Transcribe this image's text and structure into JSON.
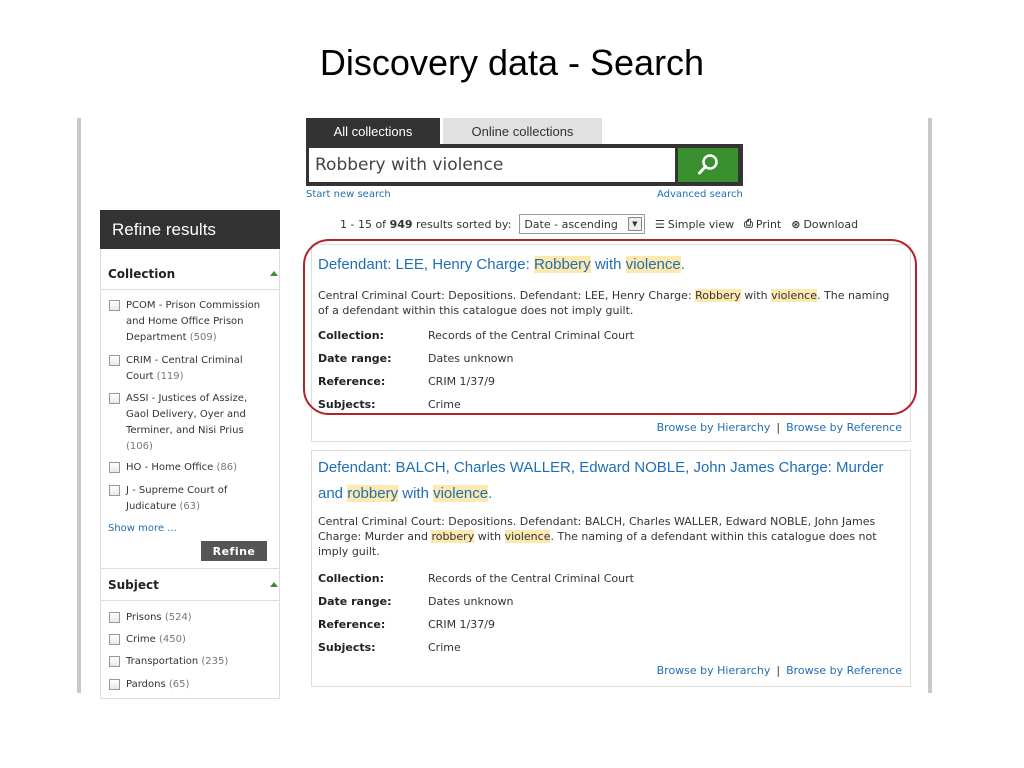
{
  "slide": {
    "title": "Discovery data - Search"
  },
  "search": {
    "tabs": [
      "All collections",
      "Online collections"
    ],
    "query": "Robbery with violence",
    "start_new": "Start new search",
    "advanced": "Advanced search"
  },
  "sidebar": {
    "header": "Refine results",
    "collection": {
      "title": "Collection",
      "items": [
        {
          "label": "PCOM - Prison Commission and Home Office Prison Department",
          "count": "(509)"
        },
        {
          "label": "CRIM - Central Criminal Court",
          "count": "(119)"
        },
        {
          "label": "ASSI - Justices of Assize, Gaol Delivery, Oyer and Terminer, and Nisi Prius",
          "count": "(106)"
        },
        {
          "label": "HO - Home Office",
          "count": "(86)"
        },
        {
          "label": "J - Supreme Court of Judicature",
          "count": "(63)"
        }
      ],
      "show_more": "Show more ...",
      "refine_button": "Refine"
    },
    "subject": {
      "title": "Subject",
      "items": [
        {
          "label": "Prisons",
          "count": "(524)"
        },
        {
          "label": "Crime",
          "count": "(450)"
        },
        {
          "label": "Transportation",
          "count": "(235)"
        },
        {
          "label": "Pardons",
          "count": "(65)"
        }
      ]
    }
  },
  "toolbar": {
    "range": "1 - 15 of",
    "total": "949",
    "sorted_by": "results sorted by:",
    "sort_value": "Date - ascending",
    "simple_view": "Simple view",
    "print": "Print",
    "download": "Download"
  },
  "results": [
    {
      "title_pre": "Defendant: LEE, Henry Charge: ",
      "title_hl1": "Robbery",
      "title_mid": " with ",
      "title_hl2": "violence",
      "title_post": ".",
      "desc_pre": "Central Criminal Court: Depositions. Defendant: LEE, Henry Charge: ",
      "desc_hl1": "Robbery",
      "desc_mid": " with ",
      "desc_hl2": "violence",
      "desc_post": ". The naming of a defendant within this catalogue does not imply guilt.",
      "meta": [
        {
          "key": "Collection:",
          "value": "Records of the Central Criminal Court"
        },
        {
          "key": "Date range:",
          "value": "Dates unknown"
        },
        {
          "key": "Reference:",
          "value": "CRIM 1/37/9"
        },
        {
          "key": "Subjects:",
          "value": "Crime"
        }
      ],
      "browse_hierarchy": "Browse by Hierarchy",
      "browse_reference": "Browse by Reference"
    },
    {
      "title_pre": "Defendant: BALCH, Charles WALLER, Edward NOBLE, John James Charge: Murder and ",
      "title_hl1": "robbery",
      "title_mid": " with ",
      "title_hl2": "violence",
      "title_post": ".",
      "desc_pre": "Central Criminal Court: Depositions. Defendant: BALCH, Charles WALLER, Edward NOBLE, John James Charge: Murder and ",
      "desc_hl1": "robbery",
      "desc_mid": " with ",
      "desc_hl2": "violence",
      "desc_post": ". The naming of a defendant within this catalogue does not imply guilt.",
      "meta": [
        {
          "key": "Collection:",
          "value": "Records of the Central Criminal Court"
        },
        {
          "key": "Date range:",
          "value": "Dates unknown"
        },
        {
          "key": "Reference:",
          "value": "CRIM 1/37/9"
        },
        {
          "key": "Subjects:",
          "value": "Crime"
        }
      ],
      "browse_hierarchy": "Browse by Hierarchy",
      "browse_reference": "Browse by Reference"
    }
  ],
  "colors": {
    "brand_dark": "#333333",
    "search_green": "#3a8f2f",
    "link_blue": "#1f6fb5",
    "highlight": "#fde8b0",
    "annotation_red": "#b4222a"
  }
}
